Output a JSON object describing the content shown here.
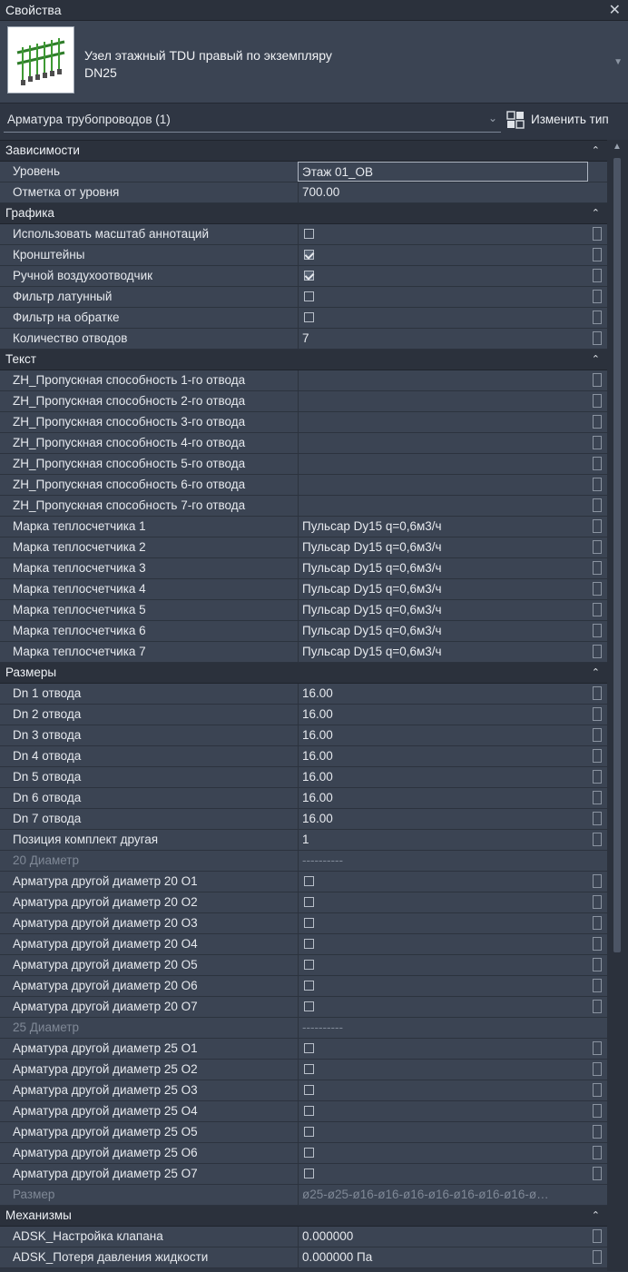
{
  "window": {
    "title": "Свойства"
  },
  "type": {
    "name_line1": "Узел этажный TDU правый по экземпляру",
    "name_line2": "DN25"
  },
  "filter": {
    "label": "Арматура трубопроводов (1)",
    "edit_type": "Изменить тип"
  },
  "colors": {
    "panel": "#2f3643",
    "row": "#3b4453",
    "section": "#2b313c",
    "text": "#e6e9ee",
    "dim_text": "#7f8896"
  },
  "sections": [
    {
      "title": "Зависимости",
      "rows": [
        {
          "name": "Уровень",
          "value": "Этаж 01_ОВ",
          "kind": "boxed"
        },
        {
          "name": "Отметка от уровня",
          "value": "700.00",
          "kind": "text"
        }
      ]
    },
    {
      "title": "Графика",
      "rows": [
        {
          "name": "Использовать масштаб аннотаций",
          "kind": "check",
          "checked": false
        },
        {
          "name": "Кронштейны",
          "kind": "check",
          "checked": true
        },
        {
          "name": "Ручной воздухоотводчик",
          "kind": "check",
          "checked": true
        },
        {
          "name": "Фильтр латунный",
          "kind": "check",
          "checked": false
        },
        {
          "name": "Фильтр на обратке",
          "kind": "check",
          "checked": false
        },
        {
          "name": "Количество отводов",
          "value": "7",
          "kind": "text"
        }
      ]
    },
    {
      "title": "Текст",
      "rows": [
        {
          "name": "ZH_Пропускная способность 1-го отвода",
          "value": "",
          "kind": "text"
        },
        {
          "name": "ZH_Пропускная способность 2-го отвода",
          "value": "",
          "kind": "text"
        },
        {
          "name": "ZH_Пропускная способность 3-го отвода",
          "value": "",
          "kind": "text"
        },
        {
          "name": "ZH_Пропускная способность 4-го отвода",
          "value": "",
          "kind": "text"
        },
        {
          "name": "ZH_Пропускная способность 5-го отвода",
          "value": "",
          "kind": "text"
        },
        {
          "name": "ZH_Пропускная способность 6-го отвода",
          "value": "",
          "kind": "text"
        },
        {
          "name": "ZH_Пропускная способность 7-го отвода",
          "value": "",
          "kind": "text"
        },
        {
          "name": "Марка теплосчетчика 1",
          "value": "Пульсар Dy15 q=0,6м3/ч",
          "kind": "text"
        },
        {
          "name": "Марка теплосчетчика 2",
          "value": "Пульсар Dy15 q=0,6м3/ч",
          "kind": "text"
        },
        {
          "name": "Марка теплосчетчика 3",
          "value": "Пульсар Dy15 q=0,6м3/ч",
          "kind": "text"
        },
        {
          "name": "Марка теплосчетчика 4",
          "value": "Пульсар Dy15 q=0,6м3/ч",
          "kind": "text"
        },
        {
          "name": "Марка теплосчетчика 5",
          "value": "Пульсар Dy15 q=0,6м3/ч",
          "kind": "text"
        },
        {
          "name": "Марка теплосчетчика 6",
          "value": "Пульсар Dy15 q=0,6м3/ч",
          "kind": "text"
        },
        {
          "name": "Марка теплосчетчика 7",
          "value": "Пульсар Dy15 q=0,6м3/ч",
          "kind": "text"
        }
      ]
    },
    {
      "title": "Размеры",
      "rows": [
        {
          "name": "Dn 1 отвода",
          "value": "16.00",
          "kind": "text"
        },
        {
          "name": "Dn 2 отвода",
          "value": "16.00",
          "kind": "text"
        },
        {
          "name": "Dn 3 отвода",
          "value": "16.00",
          "kind": "text"
        },
        {
          "name": "Dn 4 отвода",
          "value": "16.00",
          "kind": "text"
        },
        {
          "name": "Dn 5 отвода",
          "value": "16.00",
          "kind": "text"
        },
        {
          "name": "Dn 6 отвода",
          "value": "16.00",
          "kind": "text"
        },
        {
          "name": "Dn 7 отвода",
          "value": "16.00",
          "kind": "text"
        },
        {
          "name": "Позиция комплект другая",
          "value": "1",
          "kind": "text"
        },
        {
          "name": "20 Диаметр",
          "value": "----------",
          "kind": "sub"
        },
        {
          "name": "Арматура другой диаметр 20 О1",
          "kind": "check",
          "checked": false
        },
        {
          "name": "Арматура другой диаметр 20 О2",
          "kind": "check",
          "checked": false
        },
        {
          "name": "Арматура другой диаметр 20 О3",
          "kind": "check",
          "checked": false
        },
        {
          "name": "Арматура другой диаметр 20 О4",
          "kind": "check",
          "checked": false
        },
        {
          "name": "Арматура другой диаметр 20 О5",
          "kind": "check",
          "checked": false
        },
        {
          "name": "Арматура другой диаметр 20 О6",
          "kind": "check",
          "checked": false
        },
        {
          "name": "Арматура другой диаметр 20 О7",
          "kind": "check",
          "checked": false
        },
        {
          "name": "25 Диаметр",
          "value": "----------",
          "kind": "sub"
        },
        {
          "name": "Арматура другой диаметр 25 О1",
          "kind": "check",
          "checked": false
        },
        {
          "name": "Арматура другой диаметр 25 О2",
          "kind": "check",
          "checked": false
        },
        {
          "name": "Арматура другой диаметр 25 О3",
          "kind": "check",
          "checked": false
        },
        {
          "name": "Арматура другой диаметр 25 О4",
          "kind": "check",
          "checked": false
        },
        {
          "name": "Арматура другой диаметр 25 О5",
          "kind": "check",
          "checked": false
        },
        {
          "name": "Арматура другой диаметр 25 О6",
          "kind": "check",
          "checked": false
        },
        {
          "name": "Арматура другой диаметр 25 О7",
          "kind": "check",
          "checked": false
        },
        {
          "name": "Размер",
          "value": "ø25-ø25-ø16-ø16-ø16-ø16-ø16-ø16-ø16-ø…",
          "kind": "sub"
        }
      ]
    },
    {
      "title": "Механизмы",
      "rows": [
        {
          "name": "ADSK_Настройка клапана",
          "value": "0.000000",
          "kind": "text"
        },
        {
          "name": "ADSK_Потеря давления жидкости",
          "value": "0.000000 Па",
          "kind": "text"
        }
      ]
    }
  ]
}
